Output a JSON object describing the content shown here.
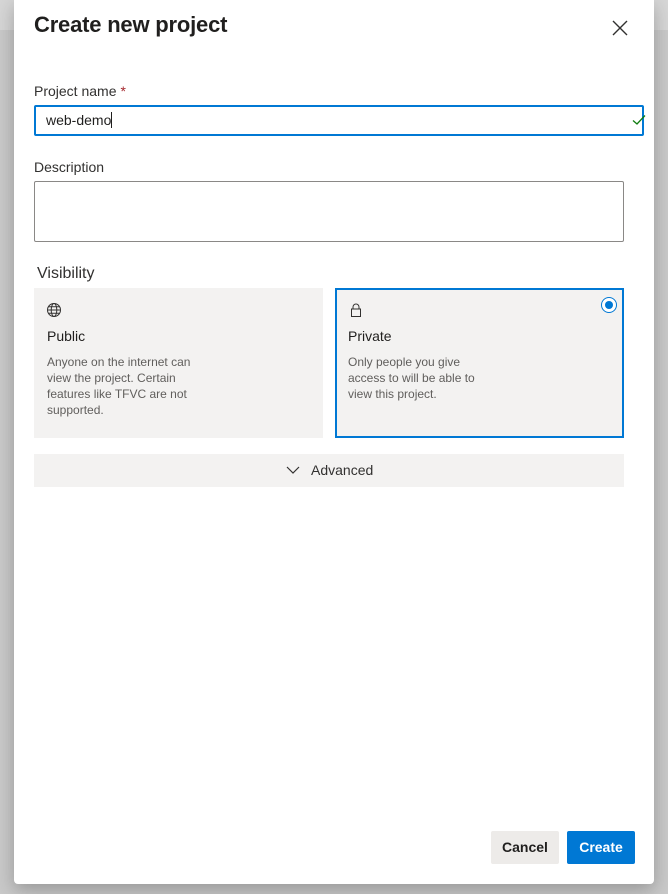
{
  "dialog": {
    "title": "Create new project",
    "close_icon": "close-icon"
  },
  "project_name": {
    "label": "Project name",
    "required_marker": "*",
    "value": "web-demo",
    "valid_icon": "checkmark-icon"
  },
  "description": {
    "label": "Description",
    "value": ""
  },
  "visibility": {
    "label": "Visibility",
    "selected": "Private",
    "options": [
      {
        "icon": "globe-icon",
        "title": "Public",
        "description": "Anyone on the internet can view the project. Certain features like TFVC are not supported."
      },
      {
        "icon": "lock-icon",
        "title": "Private",
        "description": "Only people you give access to will be able to view this project."
      }
    ]
  },
  "advanced": {
    "label": "Advanced",
    "icon": "chevron-down-icon"
  },
  "footer": {
    "cancel_label": "Cancel",
    "create_label": "Create"
  },
  "colors": {
    "accent": "#0078d4",
    "required": "#a4262c",
    "valid": "#107c10"
  }
}
